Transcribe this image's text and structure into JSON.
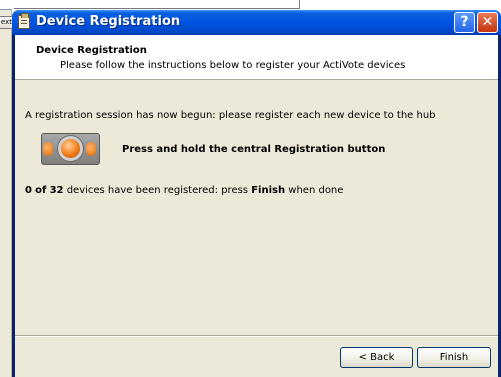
{
  "background_window": {
    "button_label": "ext"
  },
  "dialog": {
    "title": "Device Registration",
    "controls": {
      "help": "?",
      "close": "✕"
    },
    "header": {
      "title": "Device Registration",
      "subtitle": "Please follow the instructions below to register your ActiVote devices"
    },
    "body": {
      "intro": "A registration session has now begun: please register each new device to the hub",
      "instruction": "Press and hold the central Registration button",
      "status": {
        "count_registered": "0",
        "of_word": "of",
        "count_total": "32",
        "middle_text": "devices have been registered: press",
        "finish_word": "Finish",
        "end_text": "when done"
      }
    },
    "footer": {
      "back_label": "< Back",
      "finish_label": "Finish"
    }
  },
  "colors": {
    "titlebar": "#0054e3",
    "client": "#ece9d8",
    "accent_orange": "#f27a14"
  }
}
